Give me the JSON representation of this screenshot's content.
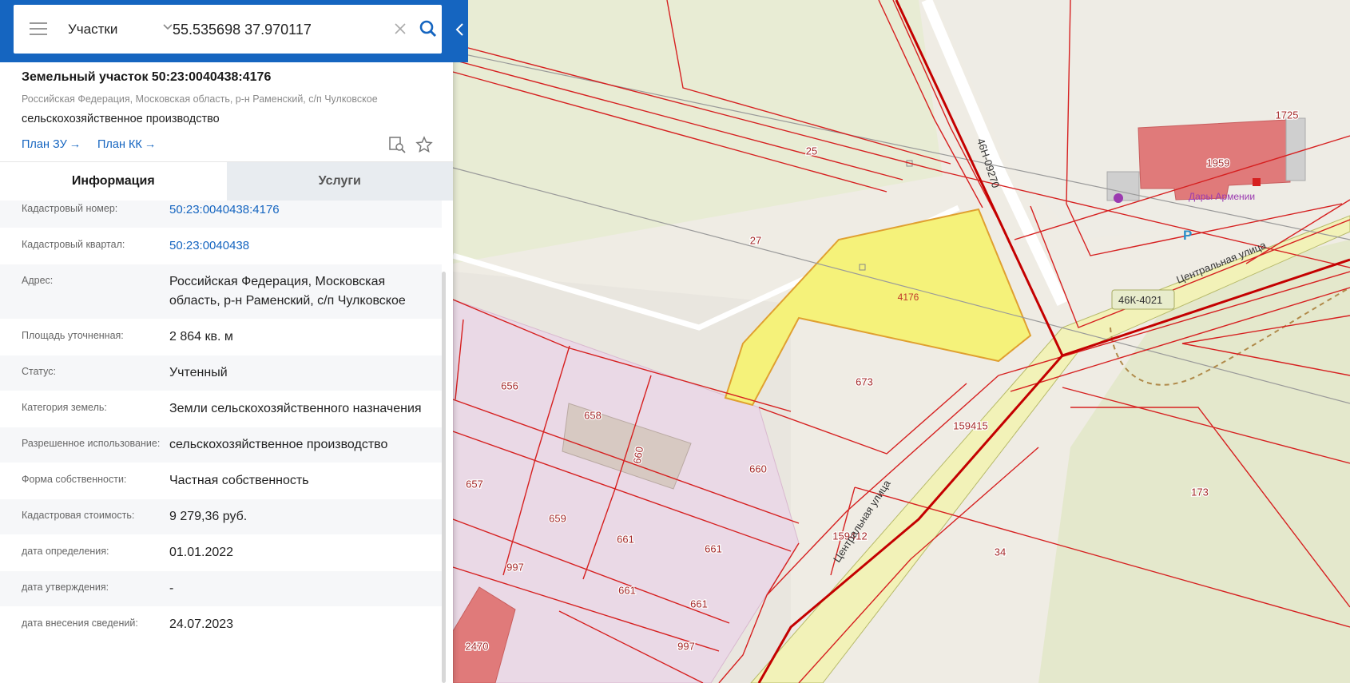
{
  "search": {
    "layer_label": "Участки",
    "query": "55.535698 37.970117"
  },
  "card": {
    "title": "Земельный участок 50:23:0040438:4176",
    "address": "Российская Федерация, Московская область, р-н Раменский, с/п Чулковское",
    "use": "сельскохозяйственное производство",
    "link_plan_zu": "План ЗУ",
    "link_plan_kk": "План КК",
    "arrow": "→"
  },
  "tabs": {
    "info": "Информация",
    "services": "Услуги"
  },
  "info": [
    {
      "key": "Кадастровый номер:",
      "value": "50:23:0040438:4176",
      "link": true
    },
    {
      "key": "Кадастровый квартал:",
      "value": "50:23:0040438",
      "link": true
    },
    {
      "key": "Адрес:",
      "value": "Российская Федерация, Московская область, р-н Раменский, с/п Чулковское",
      "link": false
    },
    {
      "key": "Площадь уточненная:",
      "value": "2 864 кв. м",
      "link": false
    },
    {
      "key": "Статус:",
      "value": "Учтенный",
      "link": false
    },
    {
      "key": "Категория земель:",
      "value": "Земли сельскохозяйственного назначения",
      "link": false
    },
    {
      "key": "Разрешенное использование:",
      "value": "сельскохозяйственное производство",
      "link": false
    },
    {
      "key": "Форма собственности:",
      "value": "Частная собственность",
      "link": false
    },
    {
      "key": "Кадастровая стоимость:",
      "value": "9 279,36 руб.",
      "link": false
    },
    {
      "key": "дата определения:",
      "value": "01.01.2022",
      "link": false
    },
    {
      "key": "дата утверждения:",
      "value": "-",
      "link": false
    },
    {
      "key": "дата внесения сведений:",
      "value": "24.07.2023",
      "link": false
    }
  ],
  "map": {
    "parcel_labels": {
      "p4176": "4176",
      "p25": "25",
      "p27": "27",
      "p673": "673",
      "p656": "656",
      "p658": "658",
      "p660a": "660",
      "p660b": "660",
      "p657": "657",
      "p659": "659",
      "p661a": "661",
      "p661b": "661",
      "p661c": "661",
      "p661d": "661",
      "p997a": "997",
      "p997b": "997",
      "p2470": "2470",
      "p159415": "159415",
      "p159412": "159412",
      "p173": "173",
      "p34": "34",
      "p1725": "1725",
      "p1959": "1959"
    },
    "road_46n": "46Н-09270",
    "road_46k": "46К-4021",
    "street_1": "Центральная улица",
    "street_2": "Центральная улица",
    "poi_name": "Дары Армении",
    "parking": "P",
    "colors": {
      "selected_fill": "#f5f27a",
      "parcel_stroke": "#d62020",
      "zone_fill": "#ead9e6",
      "building_fill": "#e07a7a",
      "brand_blue": "#1565c0"
    }
  }
}
